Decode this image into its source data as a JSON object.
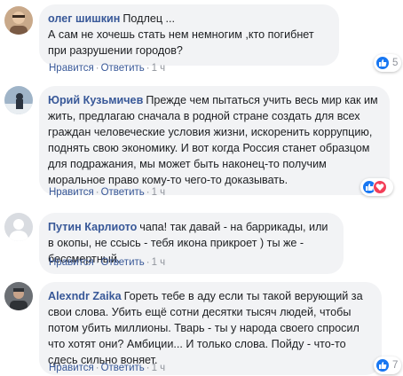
{
  "actions": {
    "like": "Нравится",
    "reply": "Ответить",
    "sep": "·"
  },
  "colors": {
    "author": "#385898",
    "bubble": "#f2f3f5",
    "like": "#1877f2",
    "love": "#f33e58"
  },
  "comments": [
    {
      "author": "олег шишкин",
      "text": "Подлец ...\nА сам не хочешь стать нем немногим ,кто погибнет при разрушении городов?",
      "time": "1 ч",
      "reactions": [
        "like"
      ],
      "reaction_count": "5"
    },
    {
      "author": "Юрий Кузьмичев",
      "text": "Прежде чем пытаться учить весь мир как им жить, предлагаю сначала в родной стране создать для всех граждан человеческие условия жизни, искоренить коррупцию, поднять свою экономику. И вот когда Россия станет образцом для подражания, мы может быть наконец-то получим моральное право кому-то чего-то доказывать.",
      "time": "1 ч",
      "reactions": [
        "like",
        "love"
      ],
      "reaction_count": ""
    },
    {
      "author": "Путин Карлиото",
      "text": "чапа! так давай - на баррикады, или в окопы, не ссысь - тебя икона прикроет ) ты же - бессмертный.",
      "time": "1 ч",
      "reactions": [],
      "reaction_count": ""
    },
    {
      "author": "Alexndr Zaika",
      "text": "Гореть тебе в аду если ты такой верующий за свои слова. Убить ещё сотни десятки тысяч людей, чтобы потом убить миллионы. Тварь - ты у народа своего спросил что хотят они? Амбиции... И только слова. Пойду - что-то сдесь сильно воняет.",
      "time": "1 ч",
      "reactions": [
        "like"
      ],
      "reaction_count": "7"
    }
  ]
}
